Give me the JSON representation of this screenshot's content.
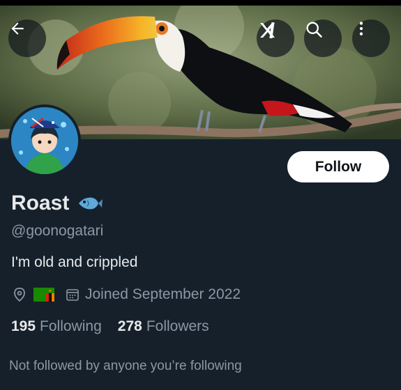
{
  "header": {
    "back_icon": "arrow-left-icon",
    "grok_icon": "grok-icon",
    "search_icon": "search-icon",
    "more_icon": "more-vertical-icon"
  },
  "banner": {
    "description_icon": "toucan-banner-image"
  },
  "profile": {
    "display_name": "Roast",
    "name_emoji": "fish-icon",
    "handle": "@goonogatari",
    "bio": "I'm old and crippled",
    "location_icon": "location-pin-icon",
    "location_flag": "zambia-flag-icon",
    "joined": "Joined September 2022",
    "following_count": "195",
    "following_label": "Following",
    "followers_count": "278",
    "followers_label": "Followers",
    "not_followed_text": "Not followed by anyone you’re following"
  },
  "actions": {
    "follow_label": "Follow"
  },
  "colors": {
    "background": "#15202b",
    "text_primary": "#e7e9ea",
    "text_secondary": "#8b98a5",
    "follow_button_bg": "#ffffff"
  }
}
